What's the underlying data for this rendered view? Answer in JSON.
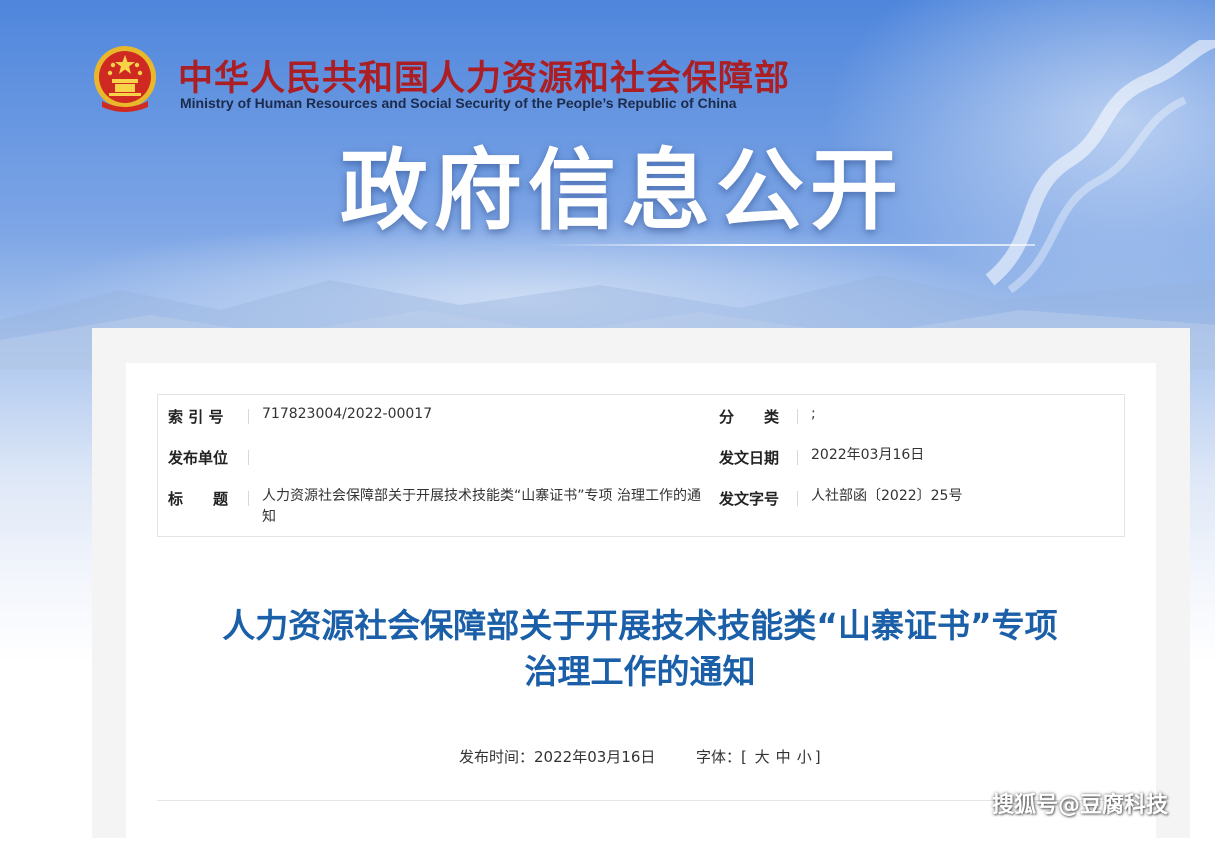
{
  "header": {
    "ministry_cn": "中华人民共和国人力资源和社会保障部",
    "ministry_en": "Ministry of Human Resources and Social Security of the People’s Republic of China",
    "banner_title": "政府信息公开"
  },
  "info": {
    "index_label": "索 引 号",
    "index_value": "717823004/2022-00017",
    "category_label": "分　　类",
    "category_value": ";",
    "publisher_label": "发布单位",
    "publisher_value": "",
    "date_label": "发文日期",
    "date_value": "2022年03月16日",
    "title_label": "标　　题",
    "title_value": "人力资源社会保障部关于开展技术技能类“山寨证书”专项 治理工作的通知",
    "docnum_label": "发文字号",
    "docnum_value": "人社部函〔2022〕25号"
  },
  "article": {
    "title_line1": "人力资源社会保障部关于开展技术技能类“山寨证书”专项",
    "title_line2": "治理工作的通知",
    "publish_time_label": "发布时间：",
    "publish_time_value": "2022年03月16日",
    "font_label": "字体：",
    "font_bracket_open": "[",
    "font_large": "大",
    "font_medium": "中",
    "font_small": "小",
    "font_bracket_close": "]"
  },
  "watermark": "搜狐号@豆腐科技",
  "colors": {
    "brand_red": "#ab1f24",
    "title_blue": "#1a5fa8",
    "banner_blue": "#4f86dc"
  },
  "icons": {
    "emblem": "national-emblem-icon"
  }
}
